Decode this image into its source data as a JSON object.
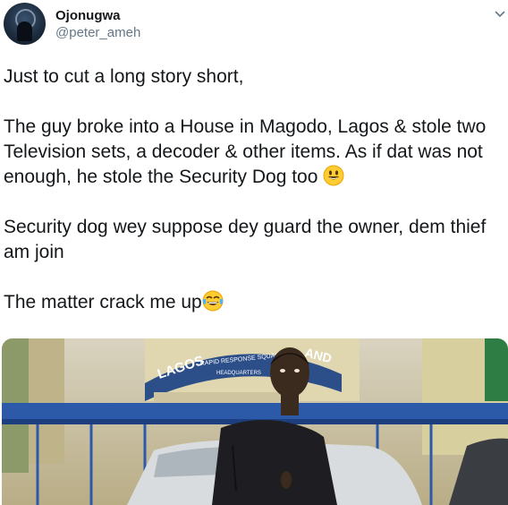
{
  "user": {
    "display_name": "Ojonugwa",
    "handle": "@peter_ameh"
  },
  "tweet": {
    "lines": [
      "Just to cut a long story short,",
      "The guy broke into a House in Magodo, Lagos & stole two Television sets, a decoder & other items. As if dat was not enough, he stole the Security Dog too",
      "Security dog wey suppose dey guard the owner, dem thief am join",
      "The matter crack me up"
    ]
  },
  "photo": {
    "sign_text_1": "LAGOS",
    "sign_text_2": "RAPID RESPONSE SQUAD",
    "sign_text_3": "HEADQUARTERS",
    "sign_text_4": "AND"
  },
  "icons": {
    "more": "chevron-down-icon",
    "emoji_1": "smiling-face-icon",
    "emoji_2": "tears-of-joy-icon"
  },
  "colors": {
    "text": "#14171a",
    "muted": "#657786",
    "background": "#ffffff"
  }
}
